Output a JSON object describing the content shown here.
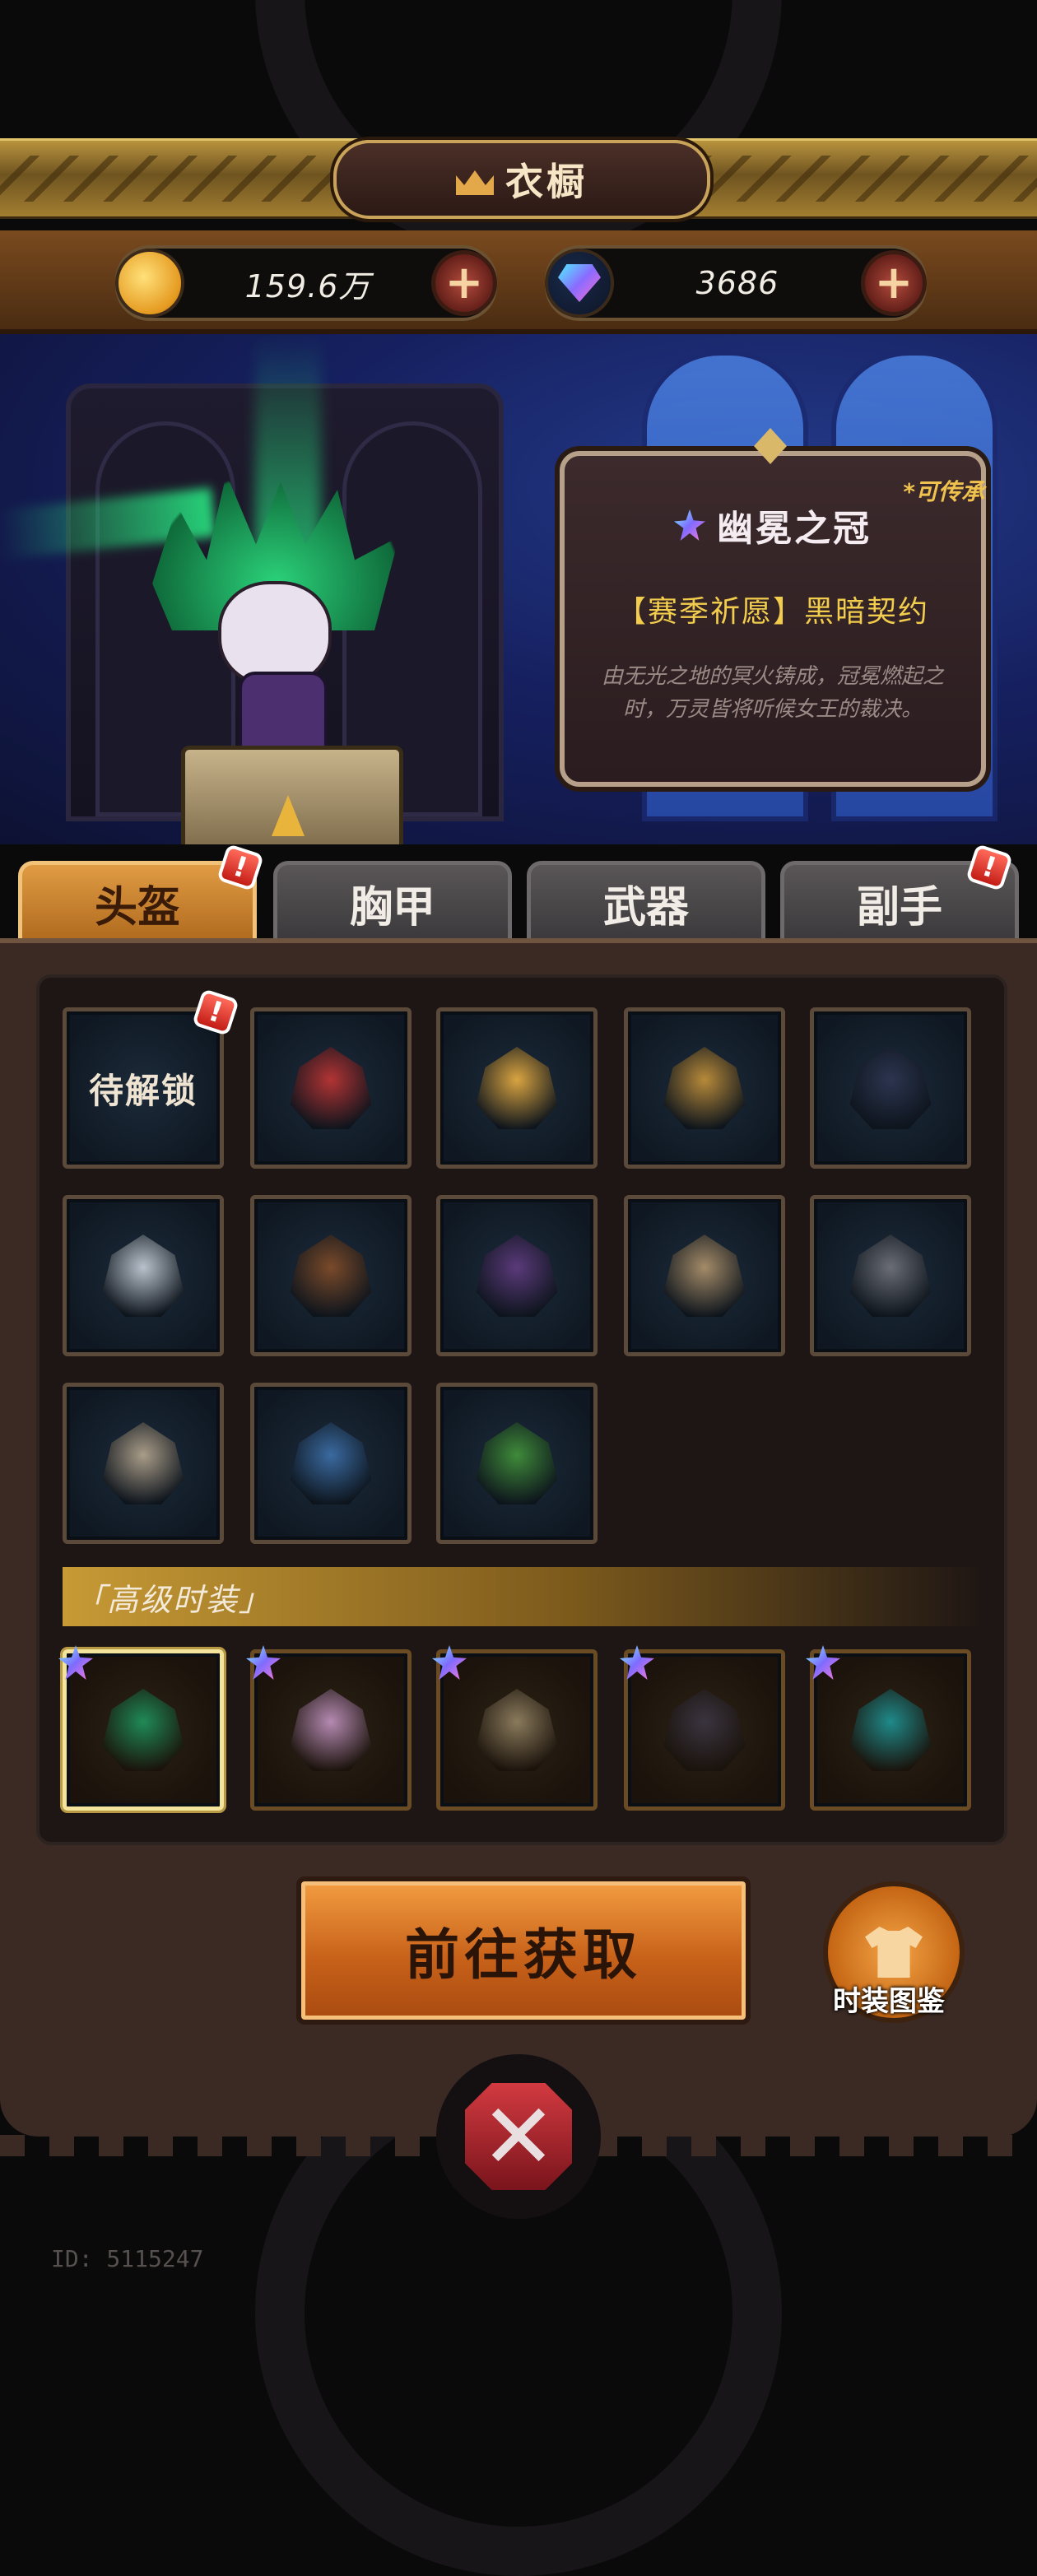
{
  "header": {
    "title": "衣橱",
    "title_icon": "crown-icon"
  },
  "currency": {
    "coins": {
      "icon": "coin-icon",
      "value": "159.6万",
      "add_icon": "plus-icon"
    },
    "gems": {
      "icon": "gem-icon",
      "value": "3686",
      "add_icon": "plus-icon"
    }
  },
  "item_card": {
    "inheritable": "*可传承",
    "rarity_icon": "star-icon",
    "name": "幽冕之冠",
    "source": "【赛季祈愿】黑暗契约",
    "description": "由无光之地的冥火铸成，冠冕燃起之时，万灵皆将听候女王的裁决。"
  },
  "tabs": [
    {
      "label": "头盔",
      "active": true,
      "alert": "!"
    },
    {
      "label": "胸甲",
      "active": false,
      "alert": ""
    },
    {
      "label": "武器",
      "active": false,
      "alert": ""
    },
    {
      "label": "副手",
      "active": false,
      "alert": "!"
    }
  ],
  "grid": {
    "locked_label": "待解锁",
    "locked_alert": "!",
    "items": [
      {
        "name": "locked-helmet-slot",
        "icon": "lock"
      },
      {
        "name": "red-hood-helmet",
        "icon": "hood-icon",
        "color": "#b23434"
      },
      {
        "name": "gold-crown",
        "icon": "crown-icon",
        "color": "#d9a441"
      },
      {
        "name": "gold-pointed-helm",
        "icon": "helmet-icon",
        "color": "#b78a3a"
      },
      {
        "name": "black-hood-mask",
        "icon": "hood-icon",
        "color": "#2c3550"
      },
      {
        "name": "silver-plume-helm",
        "icon": "helmet-icon",
        "color": "#b9c2cc"
      },
      {
        "name": "dark-tiara",
        "icon": "tiara-icon",
        "color": "#7a4a2a"
      },
      {
        "name": "purple-hood-helm",
        "icon": "hood-icon",
        "color": "#5a3a7a"
      },
      {
        "name": "bronze-knight-helm",
        "icon": "helmet-icon",
        "color": "#a48b68"
      },
      {
        "name": "dark-horned-helm",
        "icon": "helmet-icon",
        "color": "#6a6d76"
      },
      {
        "name": "eagle-helm",
        "icon": "eagle-icon",
        "color": "#a99c88"
      },
      {
        "name": "lantern-helm",
        "icon": "lantern-icon",
        "color": "#3a6aa0"
      },
      {
        "name": "leaf-wreath",
        "icon": "leaf-icon",
        "color": "#3f8a3a"
      }
    ]
  },
  "premium": {
    "label": "「高级时装」",
    "items": [
      {
        "name": "phantom-crown",
        "icon": "crown-icon",
        "color": "#1f8a56",
        "selected": true
      },
      {
        "name": "pink-horned-hood",
        "icon": "hood-icon",
        "color": "#b58ab2",
        "selected": false
      },
      {
        "name": "plague-mask",
        "icon": "mask-icon",
        "color": "#8a7a5c",
        "selected": false
      },
      {
        "name": "dark-queen-crown",
        "icon": "crown-icon",
        "color": "#3a3440",
        "selected": false
      },
      {
        "name": "skull-pirate-hat",
        "icon": "hat-icon",
        "color": "#1f8a8a",
        "selected": false
      }
    ]
  },
  "actions": {
    "obtain_label": "前往获取",
    "codex_label": "时装图鉴",
    "codex_icon": "shirt-icon",
    "close_icon": "close-icon"
  },
  "footer": {
    "id_text": "ID: 5115247"
  }
}
